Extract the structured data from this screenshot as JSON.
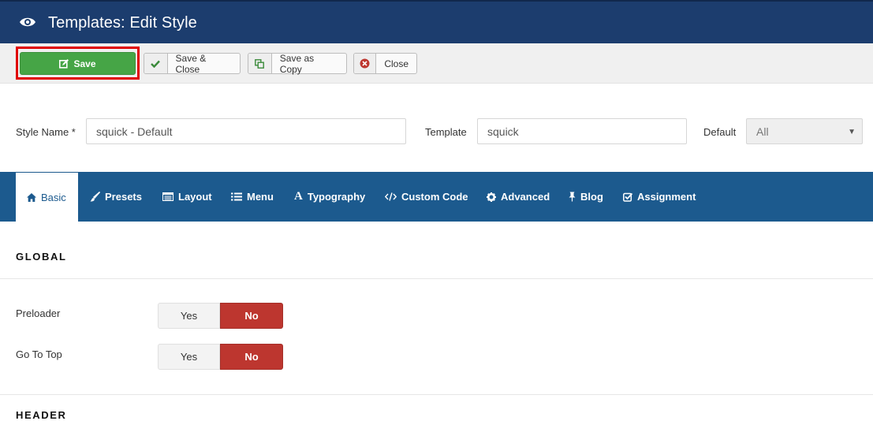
{
  "header": {
    "title": "Templates: Edit Style",
    "icon": "eye-icon"
  },
  "toolbar": {
    "save_label": "Save",
    "save_close_label": "Save & Close",
    "save_copy_label": "Save as Copy",
    "close_label": "Close"
  },
  "form": {
    "style_name_label": "Style Name *",
    "style_name_value": "squick - Default",
    "template_label": "Template",
    "template_value": "squick",
    "default_label": "Default",
    "default_value": "All"
  },
  "tabs": [
    {
      "label": "Basic",
      "icon": "home-icon"
    },
    {
      "label": "Presets",
      "icon": "brush-icon"
    },
    {
      "label": "Layout",
      "icon": "layout-icon"
    },
    {
      "label": "Menu",
      "icon": "list-icon"
    },
    {
      "label": "Typography",
      "icon": "font-icon"
    },
    {
      "label": "Custom Code",
      "icon": "code-icon"
    },
    {
      "label": "Advanced",
      "icon": "cog-icon"
    },
    {
      "label": "Blog",
      "icon": "pin-icon"
    },
    {
      "label": "Assignment",
      "icon": "check-square-icon"
    }
  ],
  "global": {
    "title": "GLOBAL",
    "preloader_label": "Preloader",
    "go_to_top_label": "Go To Top",
    "yes": "Yes",
    "no": "No"
  },
  "next_section": {
    "title": "HEADER"
  },
  "colors": {
    "header": "#1c3d6e",
    "tabs": "#1c5a8e",
    "save": "#46a546",
    "no_active": "#bd362f",
    "highlight": "#e00000"
  }
}
